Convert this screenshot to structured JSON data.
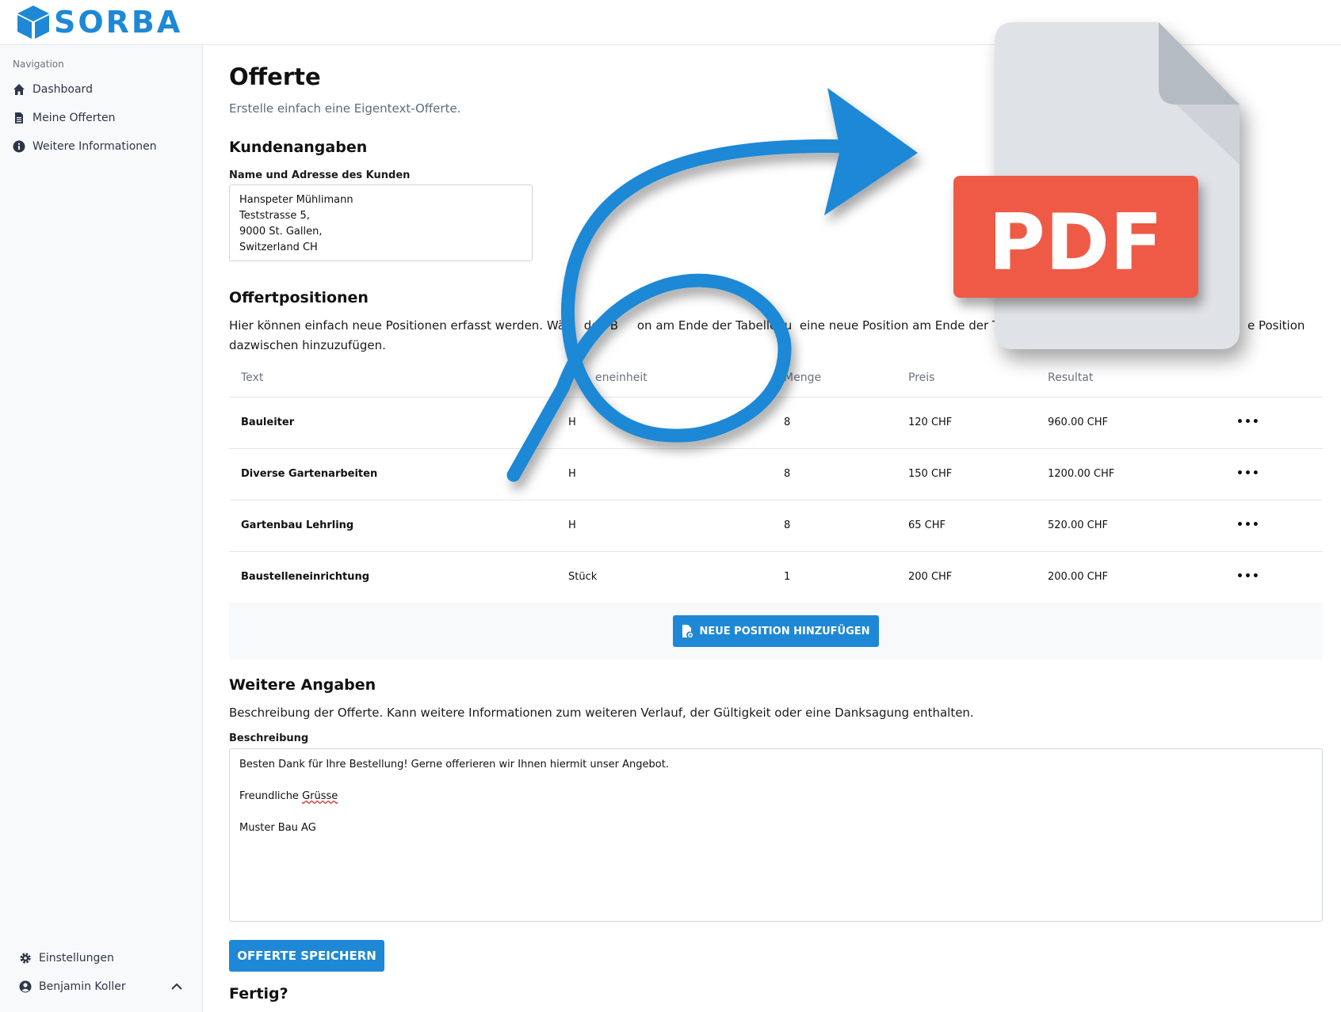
{
  "brand": {
    "name": "SORBA",
    "accent": "#1e88d6"
  },
  "sidebar": {
    "heading": "Navigation",
    "items": [
      {
        "label": "Dashboard",
        "icon": "home-icon"
      },
      {
        "label": "Meine Offerten",
        "icon": "document-icon"
      },
      {
        "label": "Weitere Informationen",
        "icon": "info-icon"
      }
    ],
    "settings_label": "Einstellungen",
    "user_name": "Benjamin Koller"
  },
  "page": {
    "title": "Offerte",
    "subtitle": "Erstelle einfach eine Eigentext-Offerte."
  },
  "customer": {
    "section_title": "Kundenangaben",
    "field_label": "Name und Adresse des Kunden",
    "lines": [
      "Hanspeter Mühlimann",
      "Teststrasse 5,",
      "9000 St. Gallen,",
      "Switzerland CH"
    ]
  },
  "positions": {
    "section_title": "Offertpositionen",
    "intro_line1": "Hier können einfach neue Positionen erfasst werden. Wäh   den B     on am Ende der Tabelle, u  eine neue Position am Ende der Tabe",
    "intro_line1_tail": "e Position",
    "intro_line2": "dazwischen hinzuzufügen.",
    "columns": [
      "Text",
      "Me   eneinheit",
      "Menge",
      "Preis",
      "Resultat"
    ],
    "rows": [
      {
        "text": "Bauleiter",
        "unit": "H",
        "qty": "8",
        "price": "120 CHF",
        "result": "960.00 CHF"
      },
      {
        "text": "Diverse Gartenarbeiten",
        "unit": "H",
        "qty": "8",
        "price": "150 CHF",
        "result": "1200.00 CHF"
      },
      {
        "text": "Gartenbau Lehrling",
        "unit": "H",
        "qty": "8",
        "price": "65 CHF",
        "result": "520.00 CHF"
      },
      {
        "text": "Baustelleneinrichtung",
        "unit": "Stück",
        "qty": "1",
        "price": "200 CHF",
        "result": "200.00 CHF"
      }
    ],
    "row_action": "•••",
    "add_button": "NEUE POSITION HINZUFÜGEN"
  },
  "more": {
    "section_title": "Weitere Angaben",
    "intro": "Beschreibung der Offerte. Kann weitere Informationen zum weiteren Verlauf, der Gültigkeit oder eine Danksagung enthalten.",
    "field_label": "Beschreibung",
    "line1": "Besten Dank für Ihre Bestellung! Gerne offerieren wir Ihnen hiermit unser Angebot.",
    "line2_a": "Freundliche ",
    "line2_b": "Grüsse",
    "line3": "Muster Bau AG"
  },
  "save_button": "OFFERTE SPEICHERN",
  "done_title": "Fertig?",
  "overlay": {
    "badge_text": "PDF",
    "badge_color": "#ef5a47",
    "arrow_color": "#1e88d6"
  }
}
